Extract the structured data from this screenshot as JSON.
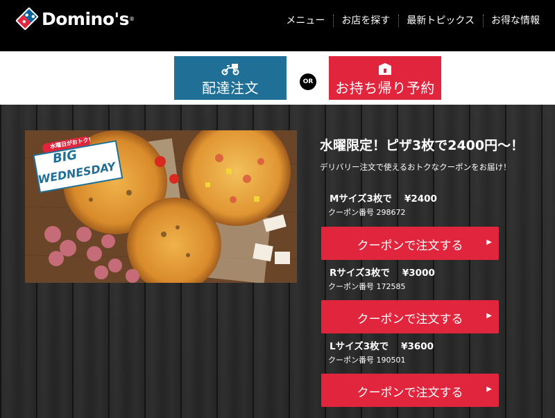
{
  "header": {
    "brand": "Domino's",
    "nav": [
      "メニュー",
      "お店を探す",
      "最新トピックス",
      "お得な情報"
    ]
  },
  "order": {
    "delivery_label": "配達注文",
    "or_label": "OR",
    "takeout_label": "お持ち帰り予約"
  },
  "promo": {
    "image_badge": "水曜日がおトク!",
    "image_title_line1": "BIG",
    "image_title_line2": "WEDNESDAY",
    "title": "水曜限定！ピザ3枚で2400円〜！",
    "subtitle": "デリバリー注文で使えるおトクなクーポンをお届け！",
    "offers": [
      {
        "name": "Mサイズ3枚で",
        "price": "¥2400",
        "code": "クーポン番号 298672",
        "button": "クーポンで注文する"
      },
      {
        "name": "Rサイズ3枚で",
        "price": "¥3000",
        "code": "クーポン番号 172585",
        "button": "クーポンで注文する"
      },
      {
        "name": "Lサイズ3枚で",
        "price": "¥3600",
        "code": "クーポン番号 190501",
        "button": "クーポンで注文する"
      }
    ]
  },
  "colors": {
    "header_bg": "#000000",
    "delivery_blue": "#1f6f96",
    "accent_red": "#e0253d",
    "logo_blue": "#0b639d",
    "wood_dark": "#2b2b2b"
  },
  "icons": [
    "domino-logo-icon",
    "delivery-scooter-icon",
    "takeout-box-icon",
    "chevron-right-icon"
  ]
}
